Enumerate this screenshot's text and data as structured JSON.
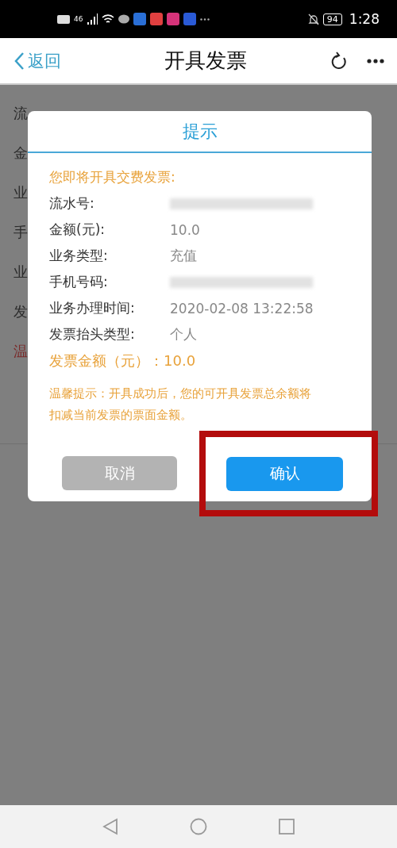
{
  "status_bar": {
    "network": "46",
    "battery": "94",
    "time": "1:28"
  },
  "nav": {
    "back": "返回",
    "title": "开具发票"
  },
  "background_labels": [
    {
      "text": "流",
      "warning": false
    },
    {
      "text": "金",
      "warning": false
    },
    {
      "text": "业",
      "warning": false
    },
    {
      "text": "手",
      "warning": false
    },
    {
      "text": "业",
      "warning": false
    },
    {
      "text": "发",
      "warning": false
    },
    {
      "text": "温",
      "warning": true
    }
  ],
  "dialog": {
    "title": "提示",
    "intro": "您即将开具交费发票:",
    "rows": [
      {
        "label": "流水号:",
        "redacted": true
      },
      {
        "label": "金额(元):",
        "value": "10.0",
        "redacted": false
      },
      {
        "label": "业务类型:",
        "value": "充值",
        "redacted": false
      },
      {
        "label": "手机号码:",
        "redacted": true
      },
      {
        "label": "业务办理时间:",
        "value": "2020-02-08 13:22:58",
        "redacted": false
      },
      {
        "label": "发票抬头类型:",
        "value": "个人",
        "redacted": false
      }
    ],
    "amount": "发票金额（元）：10.0",
    "notice": "温馨提示：开具成功后，您的可开具发票总余额将扣减当前发票的票面金额。",
    "buttons": [
      {
        "label": "取消",
        "kind": "cancel",
        "highlighted": false
      },
      {
        "label": "确认",
        "kind": "confirm",
        "highlighted": true
      }
    ]
  }
}
